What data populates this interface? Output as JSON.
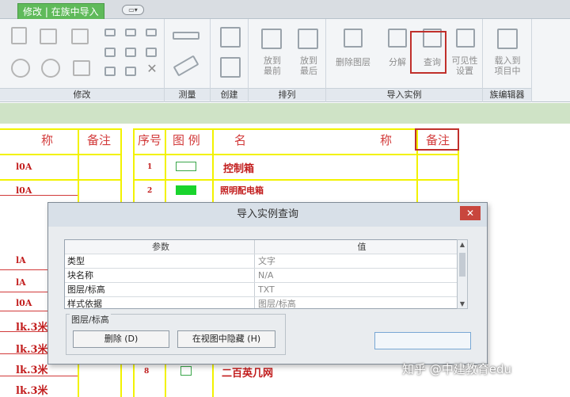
{
  "tabbar": {
    "context_tab": "修改 | 在族中导入",
    "quick_access": "▭▾"
  },
  "ribbon": {
    "panels": {
      "modify": "修改",
      "measure": "测量",
      "create": "创建",
      "arrange": "排列",
      "import_instance": "导入实例",
      "family_editor": "族编辑器"
    },
    "tools": {
      "bring_front": [
        "放到",
        "最前"
      ],
      "send_back": [
        "放到",
        "最后"
      ],
      "delete_layer": "删除图层",
      "explode": "分解",
      "query": "查询",
      "visibility": [
        "可见性",
        "设置"
      ],
      "load_project": [
        "载入到",
        "项目中"
      ]
    }
  },
  "drawing": {
    "headers": {
      "name_left": "称",
      "note_left": "备注",
      "seq": "序号",
      "legend": "图 例",
      "name": "名",
      "name2": "称",
      "note": "备注"
    },
    "left_rows": [
      "l0A",
      "l0A",
      "lA",
      "lA",
      "l0A",
      "lk.3米",
      "lk.3米",
      "lk.3米",
      "lk.3米"
    ],
    "seq_rows": [
      "1",
      "2"
    ],
    "name_rows": [
      "控制箱",
      "照明配电箱"
    ],
    "bottom_fragment": "二百英几网"
  },
  "dialog": {
    "title": "导入实例查询",
    "close": "✕",
    "columns": [
      "参数",
      "值"
    ],
    "rows": [
      {
        "param": "类型",
        "value": "文字"
      },
      {
        "param": "块名称",
        "value": "N/A"
      },
      {
        "param": "图层/标高",
        "value": "TXT"
      },
      {
        "param": "样式依据",
        "value": "图层/标高"
      }
    ],
    "group_label": "图层/标高",
    "delete_button": "删除 (D)",
    "hide_button": "在视图中隐藏 (H)"
  },
  "watermark": "知乎 @中建教育edu",
  "colors": {
    "accent_green": "#5fba5a",
    "highlight": "#c0302b",
    "drawing_red": "#d23a3a",
    "drawing_yellow": "#f2f200"
  }
}
